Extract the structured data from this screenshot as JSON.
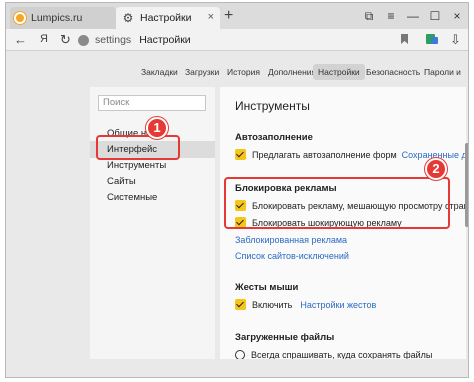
{
  "tabs": [
    {
      "label": "Lumpics.ru"
    },
    {
      "label": "Настройки"
    }
  ],
  "address": {
    "scheme": "settings",
    "title": "Настройки"
  },
  "nav_glyphs": {
    "back": "←",
    "yandex": "Я",
    "reload": "↻",
    "new_tab": "+",
    "close": "×",
    "menu": "≡",
    "minimize": "—",
    "maximize": "☐",
    "pin": "⧉"
  },
  "settings_tabs": [
    "Закладки",
    "Загрузки",
    "История",
    "Дополнения",
    "Настройки",
    "Безопасность",
    "Пароли и"
  ],
  "sidebar": {
    "search_placeholder": "Поиск",
    "items": [
      "Общие нас",
      "Интерфейс",
      "Инструменты",
      "Сайты",
      "Системные"
    ]
  },
  "content": {
    "title": "Инструменты",
    "autofill": {
      "heading": "Автозаполнение",
      "option": "Предлагать автозаполнение форм",
      "link": "Сохраненные данные"
    },
    "adblock": {
      "heading": "Блокировка рекламы",
      "option1": "Блокировать рекламу, мешающую просмотру страниц",
      "option2": "Блокировать шокирующую рекламу",
      "link1": "Заблокированная реклама",
      "link2": "Список сайтов-исключений"
    },
    "gestures": {
      "heading": "Жесты мыши",
      "option": "Включить",
      "link": "Настройки жестов"
    },
    "downloads": {
      "heading": "Загруженные файлы",
      "option": "Всегда спрашивать, куда сохранять файлы"
    }
  },
  "annotations": [
    "1",
    "2"
  ],
  "colors": {
    "annotation": "#e53935",
    "checkbox": "#f5c518",
    "link": "#2a6bc2"
  }
}
